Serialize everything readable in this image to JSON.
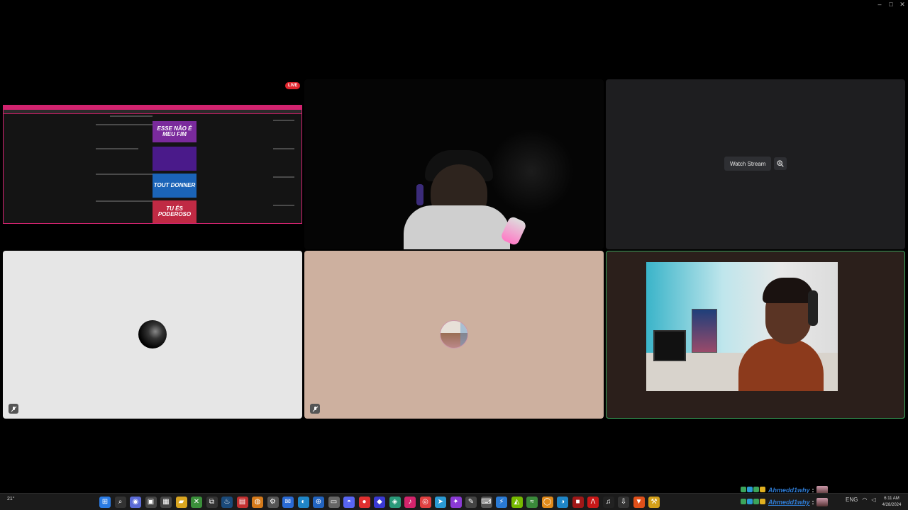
{
  "window_controls": {
    "minimize": "–",
    "maximize": "□",
    "close": "✕"
  },
  "screen_share": {
    "live_badge": "LIVE",
    "thumbnails": [
      {
        "label": "ESSE NÃO É MEU FIM",
        "color": "#7a2a9c"
      },
      {
        "label": "",
        "color": "#4a1a8a"
      },
      {
        "label": "TOUT DONNER",
        "color": "#1b64b8"
      },
      {
        "label": "TU ÉS PODEROSO",
        "color": "#c02a44"
      }
    ]
  },
  "stream_tile": {
    "watch_label": "Watch Stream",
    "zoom_icon": "zoom-in-icon"
  },
  "participants": [
    {
      "id": "p1",
      "muted": true,
      "mute_icon": "mic-off-icon"
    },
    {
      "id": "p2",
      "muted": true,
      "mute_icon": "mic-off-icon"
    },
    {
      "id": "p3",
      "speaking": true,
      "accent": "#3ba55c"
    }
  ],
  "taskbar": {
    "weather": "21°",
    "apps": [
      {
        "name": "start-icon",
        "glyph": "⊞",
        "color": "#2a7be4"
      },
      {
        "name": "search-icon",
        "glyph": "⌕",
        "color": "#333"
      },
      {
        "name": "copilot-icon",
        "glyph": "◉",
        "color": "#5b6bd6"
      },
      {
        "name": "task-view-icon",
        "glyph": "▣",
        "color": "#444"
      },
      {
        "name": "widgets-icon",
        "glyph": "▦",
        "color": "#444"
      },
      {
        "name": "file-explorer-icon",
        "glyph": "▰",
        "color": "#d9a520"
      },
      {
        "name": "xbox-icon",
        "glyph": "✕",
        "color": "#3a8f3a"
      },
      {
        "name": "capcut-icon",
        "glyph": "⧉",
        "color": "#333"
      },
      {
        "name": "steam-icon",
        "glyph": "♨",
        "color": "#1b4a7a"
      },
      {
        "name": "pdf-icon",
        "glyph": "▤",
        "color": "#c23030"
      },
      {
        "name": "blender-icon",
        "glyph": "◍",
        "color": "#d57a1a"
      },
      {
        "name": "gear-icon",
        "glyph": "⚙",
        "color": "#555"
      },
      {
        "name": "mail-icon",
        "glyph": "✉",
        "color": "#2a6ad4"
      },
      {
        "name": "edge-icon",
        "glyph": "◐",
        "color": "#1f86c8"
      },
      {
        "name": "store-icon",
        "glyph": "⊕",
        "color": "#2264c0"
      },
      {
        "name": "notes-icon",
        "glyph": "▭",
        "color": "#666"
      },
      {
        "name": "discord-icon",
        "glyph": "◓",
        "color": "#5865f2"
      },
      {
        "name": "notification-icon",
        "glyph": "●",
        "color": "#e03030"
      },
      {
        "name": "cube-icon",
        "glyph": "◆",
        "color": "#3a3ad4"
      },
      {
        "name": "chat-icon",
        "glyph": "◈",
        "color": "#2a9a7a"
      },
      {
        "name": "tiktok-icon",
        "glyph": "♪",
        "color": "#d4246c"
      },
      {
        "name": "chrome-icon",
        "glyph": "◎",
        "color": "#e04040"
      },
      {
        "name": "telegram-icon",
        "glyph": "➤",
        "color": "#2a9ad4"
      },
      {
        "name": "sparkle-icon",
        "glyph": "✦",
        "color": "#8a3ad4"
      },
      {
        "name": "editor-icon",
        "glyph": "✎",
        "color": "#444"
      },
      {
        "name": "terminal-icon",
        "glyph": "⌨",
        "color": "#555"
      },
      {
        "name": "bolt-icon",
        "glyph": "⚡",
        "color": "#2a7ad4"
      },
      {
        "name": "nvidia-icon",
        "glyph": "◭",
        "color": "#76b900"
      },
      {
        "name": "snake-icon",
        "glyph": "≈",
        "color": "#3a8a3a"
      },
      {
        "name": "browser-icon",
        "glyph": "◯",
        "color": "#e08a1a"
      },
      {
        "name": "edge2-icon",
        "glyph": "◑",
        "color": "#1f86c8"
      },
      {
        "name": "red-app-icon",
        "glyph": "■",
        "color": "#a01818"
      },
      {
        "name": "adobe-icon",
        "glyph": "Λ",
        "color": "#c81818"
      },
      {
        "name": "music-icon",
        "glyph": "♫",
        "color": "#222"
      },
      {
        "name": "download-icon",
        "glyph": "⇩",
        "color": "#333"
      },
      {
        "name": "brave-icon",
        "glyph": "▼",
        "color": "#e0501a"
      },
      {
        "name": "tools-icon",
        "glyph": "⚒",
        "color": "#d4a01a"
      },
      {
        "name": "game-icon",
        "glyph": "◉",
        "color": "#c01a1a"
      },
      {
        "name": "controller-icon",
        "glyph": "◘",
        "color": "#c83030"
      },
      {
        "name": "paint-icon",
        "glyph": "✿",
        "color": "#d47a1a"
      },
      {
        "name": "shield-icon",
        "glyph": "⛨",
        "color": "#2a6ad4"
      },
      {
        "name": "medal-icon",
        "glyph": "✪",
        "color": "#d4a01a"
      },
      {
        "name": "leaf-icon",
        "glyph": "❦",
        "color": "#3a3a3a"
      },
      {
        "name": "window-icon",
        "glyph": "▢",
        "color": "#2a6ad4"
      },
      {
        "name": "home-icon",
        "glyph": "⌂",
        "color": "#333"
      }
    ],
    "tray": {
      "language": "ENG",
      "wifi_icon": "wifi-icon",
      "volume_icon": "speaker-icon"
    },
    "time": "6:11 AM",
    "date": "4/28/2024"
  },
  "overlay_chat": [
    {
      "username": "Ahmedd1why",
      "colon": ":"
    },
    {
      "username": "Ahmedd1why",
      "colon": ":"
    }
  ]
}
